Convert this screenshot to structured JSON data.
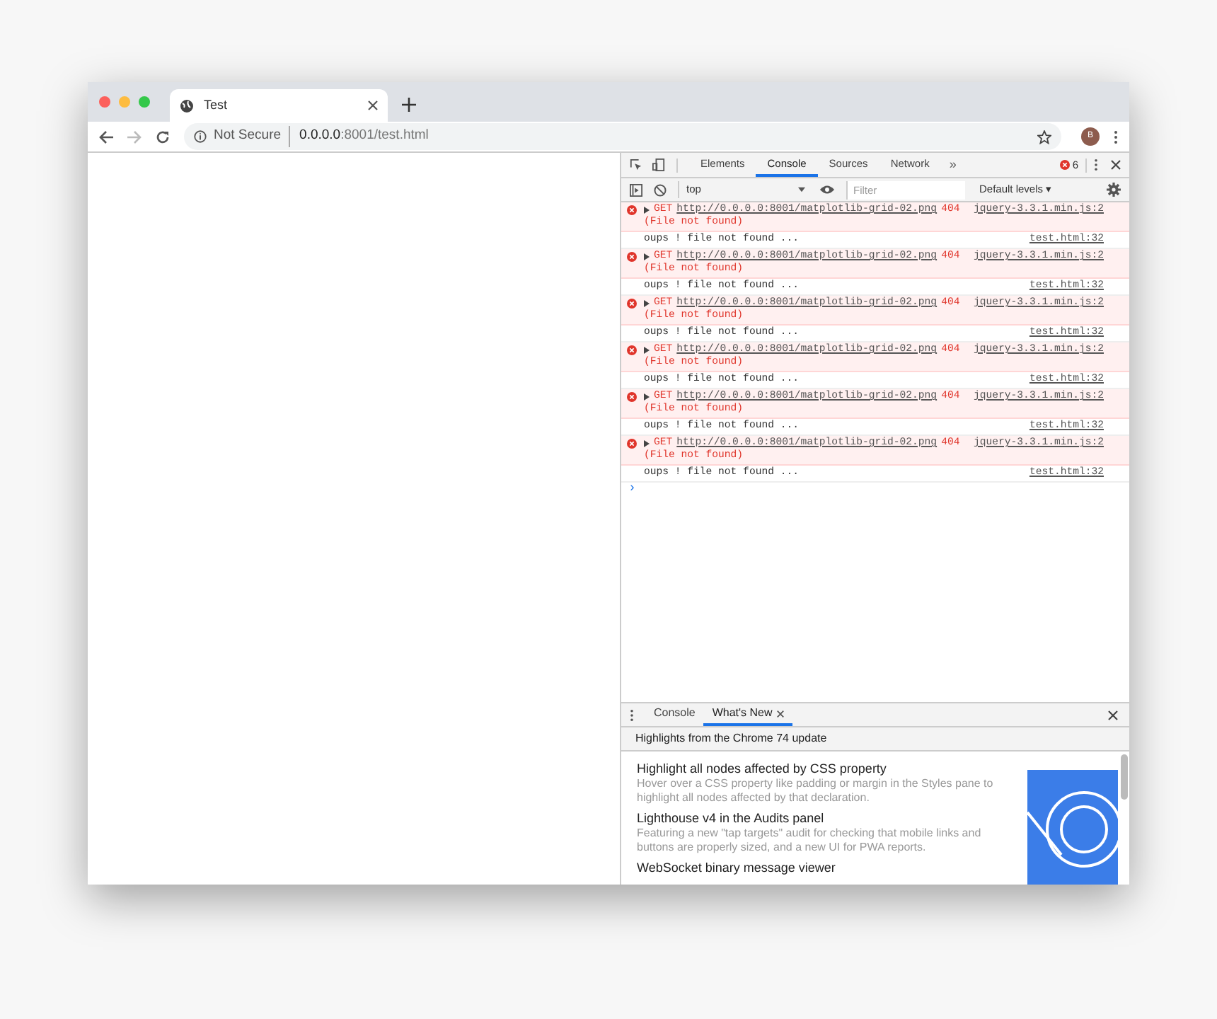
{
  "tab": {
    "title": "Test",
    "selected": true
  },
  "address": {
    "security": "Not Secure",
    "host": "0.0.0.0",
    "path": ":8001/test.html"
  },
  "profile": {
    "initial": "B"
  },
  "devtools": {
    "tabs": [
      {
        "label": "Elements",
        "selected": false
      },
      {
        "label": "Console",
        "selected": true
      },
      {
        "label": "Sources",
        "selected": false
      },
      {
        "label": "Network",
        "selected": false
      }
    ],
    "more": "»",
    "error_count": "6",
    "context": "top",
    "filter_placeholder": "Filter",
    "levels": "Default levels ▾",
    "messages": [
      {
        "kind": "error",
        "method": "GET",
        "url": "http://0.0.0.0:8001/matplotlib-grid-02.png",
        "status": "404",
        "detail": "(File not found)",
        "source": "jquery-3.3.1.min.js:2"
      },
      {
        "kind": "log",
        "text": "oups ! file not found ...",
        "source": "test.html:32"
      },
      {
        "kind": "error",
        "method": "GET",
        "url": "http://0.0.0.0:8001/matplotlib-grid-02.png",
        "status": "404",
        "detail": "(File not found)",
        "source": "jquery-3.3.1.min.js:2"
      },
      {
        "kind": "log",
        "text": "oups ! file not found ...",
        "source": "test.html:32"
      },
      {
        "kind": "error",
        "method": "GET",
        "url": "http://0.0.0.0:8001/matplotlib-grid-02.png",
        "status": "404",
        "detail": "(File not found)",
        "source": "jquery-3.3.1.min.js:2"
      },
      {
        "kind": "log",
        "text": "oups ! file not found ...",
        "source": "test.html:32"
      },
      {
        "kind": "error",
        "method": "GET",
        "url": "http://0.0.0.0:8001/matplotlib-grid-02.png",
        "status": "404",
        "detail": "(File not found)",
        "source": "jquery-3.3.1.min.js:2"
      },
      {
        "kind": "log",
        "text": "oups ! file not found ...",
        "source": "test.html:32"
      },
      {
        "kind": "error",
        "method": "GET",
        "url": "http://0.0.0.0:8001/matplotlib-grid-02.png",
        "status": "404",
        "detail": "(File not found)",
        "source": "jquery-3.3.1.min.js:2"
      },
      {
        "kind": "log",
        "text": "oups ! file not found ...",
        "source": "test.html:32"
      },
      {
        "kind": "error",
        "method": "GET",
        "url": "http://0.0.0.0:8001/matplotlib-grid-02.png",
        "status": "404",
        "detail": "(File not found)",
        "source": "jquery-3.3.1.min.js:2"
      },
      {
        "kind": "log",
        "text": "oups ! file not found ...",
        "source": "test.html:32"
      }
    ],
    "prompt": "›"
  },
  "drawer": {
    "tabs": [
      {
        "label": "Console",
        "selected": false,
        "closable": false
      },
      {
        "label": "What's New",
        "selected": true,
        "closable": true
      }
    ],
    "heading": "Highlights from the Chrome 74 update",
    "items": [
      {
        "title": "Highlight all nodes affected by CSS property",
        "text": "Hover over a CSS property like padding or margin in the Styles pane to highlight all nodes affected by that declaration."
      },
      {
        "title": "Lighthouse v4 in the Audits panel",
        "text": "Featuring a new \"tap targets\" audit for checking that mobile links and buttons are properly sized, and a new UI for PWA reports."
      },
      {
        "title": "WebSocket binary message viewer"
      }
    ]
  }
}
